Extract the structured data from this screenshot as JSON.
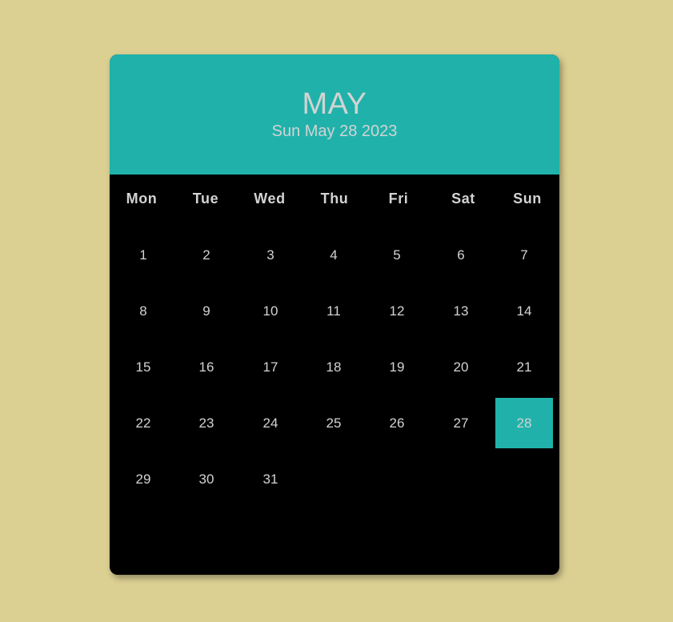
{
  "header": {
    "month": "MAY",
    "full_date": "Sun May 28 2023"
  },
  "weekdays": [
    "Mon",
    "Tue",
    "Wed",
    "Thu",
    "Fri",
    "Sat",
    "Sun"
  ],
  "days": [
    "1",
    "2",
    "3",
    "4",
    "5",
    "6",
    "7",
    "8",
    "9",
    "10",
    "11",
    "12",
    "13",
    "14",
    "15",
    "16",
    "17",
    "18",
    "19",
    "20",
    "21",
    "22",
    "23",
    "24",
    "25",
    "26",
    "27",
    "28",
    "29",
    "30",
    "31"
  ],
  "selected_day": "28",
  "colors": {
    "page_background": "#dbcf92",
    "accent": "#20b2aa",
    "calendar_background": "#000000",
    "text": "#d3d3d3"
  }
}
